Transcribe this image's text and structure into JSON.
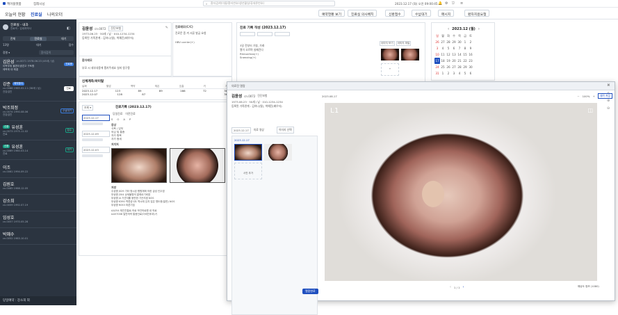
{
  "topbar": {
    "brand": "케어플랫폼",
    "user": "집레시닝",
    "search": "환자검색(이름/환자번호/생년월일/휴대폰번호)",
    "datetime": "2023.12.17 (화) 오전 09:00:45"
  },
  "nav": {
    "tabs": [
      "오늘의 현황",
      "진료실",
      "나의오더"
    ],
    "active": 1,
    "buttons": [
      "예약현황 보기",
      "진료실 의사배치",
      "신환접수",
      "수납대기",
      "메시지",
      "환자지원요청"
    ]
  },
  "sidebar": {
    "user_name": "진료실 - 내과",
    "user_sub": "진료의 : 김내과의사",
    "filters": [
      "전체",
      "진료실",
      "대기"
    ],
    "counts": [
      "13명",
      "대기",
      "접수"
    ],
    "search_placeholder": "환자검색",
    "patients": [
      {
        "name": "김윤성",
        "sub": "cn.0071 1978.06.23 (45세 / 남)",
        "note": "이목부위 불편이생겼고 구토함",
        "note2": "제목에 대 해결",
        "badge": "진료중",
        "badge_color": "#3b7de0"
      },
      {
        "name": "강준",
        "sub": "cn.0088 1985.02.11 (38세 / 남)",
        "note": "건강검진",
        "badge": "진료",
        "badge_color": "#1d1d1d"
      },
      {
        "name": "박조희정",
        "sub": "cn.0074 1990.08.06",
        "note": "건강검진",
        "badge": "수납대기",
        "badge_color": "#3b7de0"
      },
      {
        "name": "유성훈",
        "sub": "cn.0073 1975.11.02",
        "note": "진료",
        "badge": "접수",
        "badge_color": "#16a085"
      },
      {
        "name": "유성훈",
        "sub": "cn.0069 1980.03.14",
        "note": "진료",
        "badge": "대기",
        "badge_color": "#16a085"
      },
      {
        "name": "이조",
        "sub": "cn.0061 1994.09.22",
        "note": "진료",
        "badge": "",
        "badge_color": "#16a085"
      },
      {
        "name": "김원호",
        "sub": "cn.0065 1988.12.05",
        "note": "진료",
        "badge": "",
        "badge_color": "#16a085"
      },
      {
        "name": "강소희",
        "sub": "cn.0059 1992.07.19",
        "note": "진료",
        "badge": "",
        "badge_color": "#16a085"
      },
      {
        "name": "임성호",
        "sub": "cn.0057 1970.05.28",
        "note": "진료",
        "badge": "",
        "badge_color": "#16a085"
      },
      {
        "name": "박혜수",
        "sub": "cn.0052 1983.10.01",
        "note": "진료",
        "badge": "",
        "badge_color": "#16a085"
      }
    ],
    "footer": "당일예약 : 강소희 외"
  },
  "patient_card": {
    "name": "김윤성",
    "id": "cn.0072",
    "tag": "진단보험",
    "line1": "1973.06.23 · 50세 / 남 · 010-1234-1234",
    "line2": "등록된 가족관계 : 김하나(딸), 박예진(배우자)",
    "memo_title": "환자메모",
    "memo": "부모 시 세부내용에 팸지주세요 실비 청구용"
  },
  "chart_note": {
    "title": "진료메모(C/C)",
    "text": "진료문 증 끼 서류 발급 요청",
    "text2": "HBV carrier(+)"
  },
  "vitals": {
    "title": "신체계측/바이탈",
    "headers": [
      "날짜",
      "혈압",
      "맥박",
      "체온",
      "호흡",
      "키",
      "체중"
    ],
    "rows": [
      [
        "2023.12.17",
        "123",
        "89",
        "89",
        "166",
        "72",
        "36.4"
      ],
      [
        "2023.12.07",
        "128",
        "87",
        "",
        "",
        "",
        "36.6"
      ]
    ]
  },
  "history": {
    "title": "진료기록 (2023.12.17)",
    "tabs": [
      "당일진료",
      "이전진료"
    ],
    "dates": [
      "2023.12.17",
      "2023.12.09",
      "2023.12.03"
    ],
    "soap": [
      "S",
      "O",
      "A",
      "P"
    ],
    "symptom_title": "증상",
    "symptom_lines": [
      "식욕 / 입덧",
      "의심 및 통증",
      "자가 항목",
      "자가 증세"
    ],
    "exam_title": "처치처",
    "dx_title": "처방",
    "dx_list": [
      "주상병  J029  기타 명시된 병원체에 의한 급성 인두염",
      "부상병  J304  상세불명의 알레르기비염",
      "부상병  J4    기관지를 동반한 기관지염 NOS",
      "부상병  K590  역류성식도 역시에 있지 않은 명도증(일반) NOS",
      "부상병  R053  마른기침"
    ],
    "rx_list": [
      "AA254  재진진찰료-의료 보건의료원 내 의료",
      "AA57008  일반의약 통증진료(이비인후과)기"
    ]
  },
  "record_panel": {
    "title": "진료 기록 작성 (2023.12.17)",
    "lines": [
      "3일 전부터 기침, 가래",
      "열이 오르며 실패진다",
      "Rhinorrhea(+)",
      "Sneezing(+)"
    ],
    "view_label": "내시경 검사",
    "view_btn": "이미지 보기",
    "view_btn2": "이미지 파일"
  },
  "calendar": {
    "title": "2023.12 (월)",
    "days": [
      "일",
      "월",
      "화",
      "수",
      "목",
      "금",
      "토"
    ],
    "weeks": [
      [
        "26",
        "27",
        "28",
        "29",
        "30",
        "1",
        "2"
      ],
      [
        "3",
        "4",
        "5",
        "6",
        "7",
        "8",
        "9"
      ],
      [
        "10",
        "11",
        "12",
        "13",
        "14",
        "15",
        "16"
      ],
      [
        "17",
        "18",
        "19",
        "20",
        "21",
        "22",
        "23"
      ],
      [
        "24",
        "25",
        "26",
        "27",
        "28",
        "29",
        "30"
      ],
      [
        "31",
        "1",
        "2",
        "3",
        "4",
        "5",
        "6"
      ]
    ]
  },
  "viewer": {
    "title": "의료진 열람",
    "name": "김윤성",
    "id": "cn.0072",
    "tag": "진단보험",
    "line1": "1973.06.23 · 50세 / 남 · 010-1234-1234",
    "line2": "등록된 가족관계 : 김하나(딸), 박예진(배우자)",
    "date": "2023.12.17",
    "type": "의료 영상",
    "btn_select": "이미지 선택",
    "thumb_date": "2023.12.17",
    "thumb_add": "사진 추가",
    "stage_date": "2023.08.17",
    "zoom": "100%",
    "btn_save": "내려 저장",
    "label_l1": "L1",
    "pager": "1 / 1",
    "footer_btn": "열람완료",
    "footer_size": "해상도 정보 (1080)"
  },
  "colors": {
    "accent": "#1f4fbf",
    "sidebar": "#2b3440",
    "ok": "#16a085"
  }
}
